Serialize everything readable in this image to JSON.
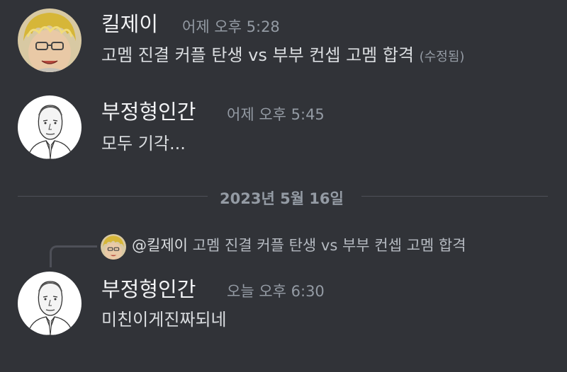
{
  "messages": [
    {
      "author": "킬제이",
      "timestamp": "어제 오후 5:28",
      "text": "고멤 진결 커플 탄생 vs 부부 컨셉 고멤 합격",
      "edited_label": "(수정됨)",
      "avatar": "blonde-avatar"
    },
    {
      "author": "부정형인간",
      "timestamp": "어제 오후 5:45",
      "text": "모두 기각...",
      "avatar": "sketch-man-avatar"
    },
    {
      "author": "부정형인간",
      "timestamp": "오늘 오후 6:30",
      "text": "미친이게진짜되네",
      "avatar": "sketch-man-avatar"
    }
  ],
  "divider": {
    "date": "2023년 5월 16일"
  },
  "reply": {
    "mention": "@킬제이",
    "text": "고멤 진결 커플 탄생 vs 부부 컨셉 고멤 합격"
  },
  "colors": {
    "background": "#313338",
    "name": "#f2f3f5",
    "text": "#dbdee1",
    "muted": "#949ba4"
  }
}
